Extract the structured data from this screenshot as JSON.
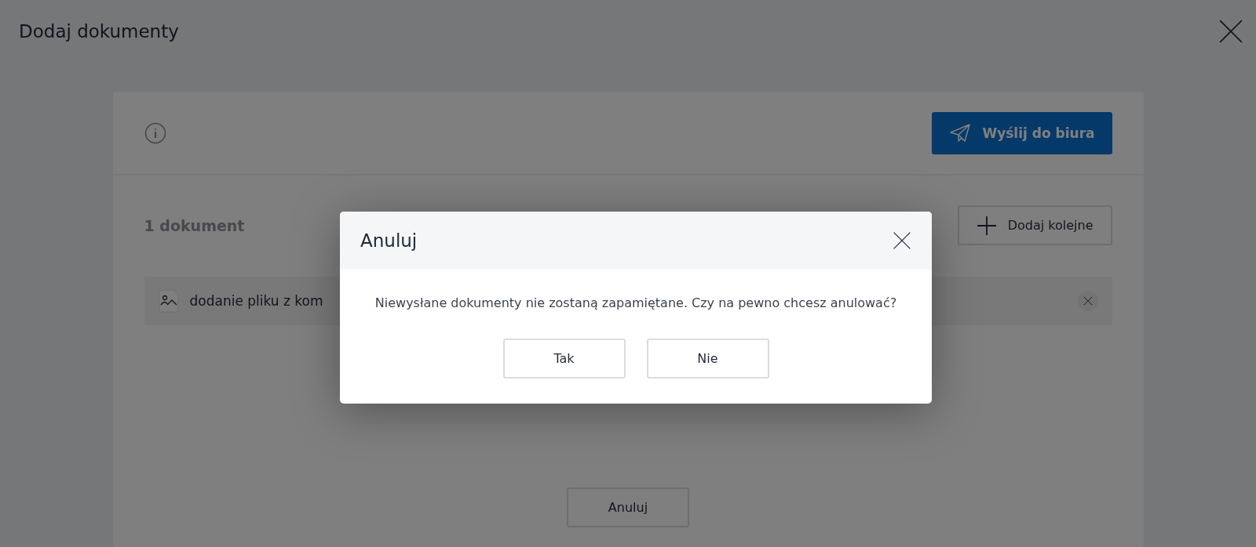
{
  "page": {
    "title": "Dodaj dokumenty"
  },
  "card": {
    "send_button": "Wyślij do biura",
    "count": "1 dokument",
    "add_button": "Dodaj kolejne",
    "files": [
      {
        "name": "dodanie pliku z kom"
      }
    ],
    "cancel_button": "Anuluj"
  },
  "dialog": {
    "title": "Anuluj",
    "message": "Niewysłane dokumenty nie zostaną zapamiętane. Czy na pewno chcesz anulować?",
    "buttons": [
      "Tak",
      "Nie"
    ]
  }
}
